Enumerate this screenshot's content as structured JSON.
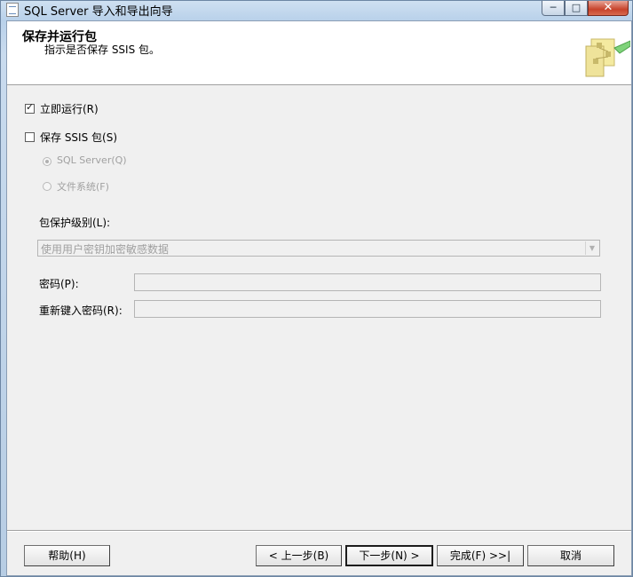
{
  "window": {
    "title": "SQL Server 导入和导出向导",
    "controls": {
      "minimize": "─",
      "maximize": "□",
      "close": "✕"
    }
  },
  "header": {
    "title": "保存并运行包",
    "subtitle": "指示是否保存 SSIS 包。",
    "graphic_icon": "wizard-graphic-icon"
  },
  "options": {
    "run_immediately": {
      "label": "立即运行(R)",
      "checked": true,
      "tick": "✓"
    },
    "save_ssis_package": {
      "label": "保存 SSIS 包(S)",
      "checked": false
    },
    "sql_server": {
      "label": "SQL Server(Q)",
      "selected": true,
      "enabled": false
    },
    "file_system": {
      "label": "文件系统(F)",
      "selected": false,
      "enabled": false
    }
  },
  "protection": {
    "label": "包保护级别(L):",
    "selected_value": "使用用户密钥加密敏感数据",
    "arrow": "▼"
  },
  "password": {
    "label": "密码(P):",
    "value": "",
    "retype_label": "重新键入密码(R):",
    "retype_value": ""
  },
  "buttons": {
    "help": "帮助(H)",
    "back": "< 上一步(B)",
    "next": "下一步(N) >",
    "finish": "完成(F) >>|",
    "cancel": "取消"
  },
  "colors": {
    "accent": "#b9d1ea",
    "disabled_text": "#a0a0a0",
    "close_button": "#c7432b"
  }
}
